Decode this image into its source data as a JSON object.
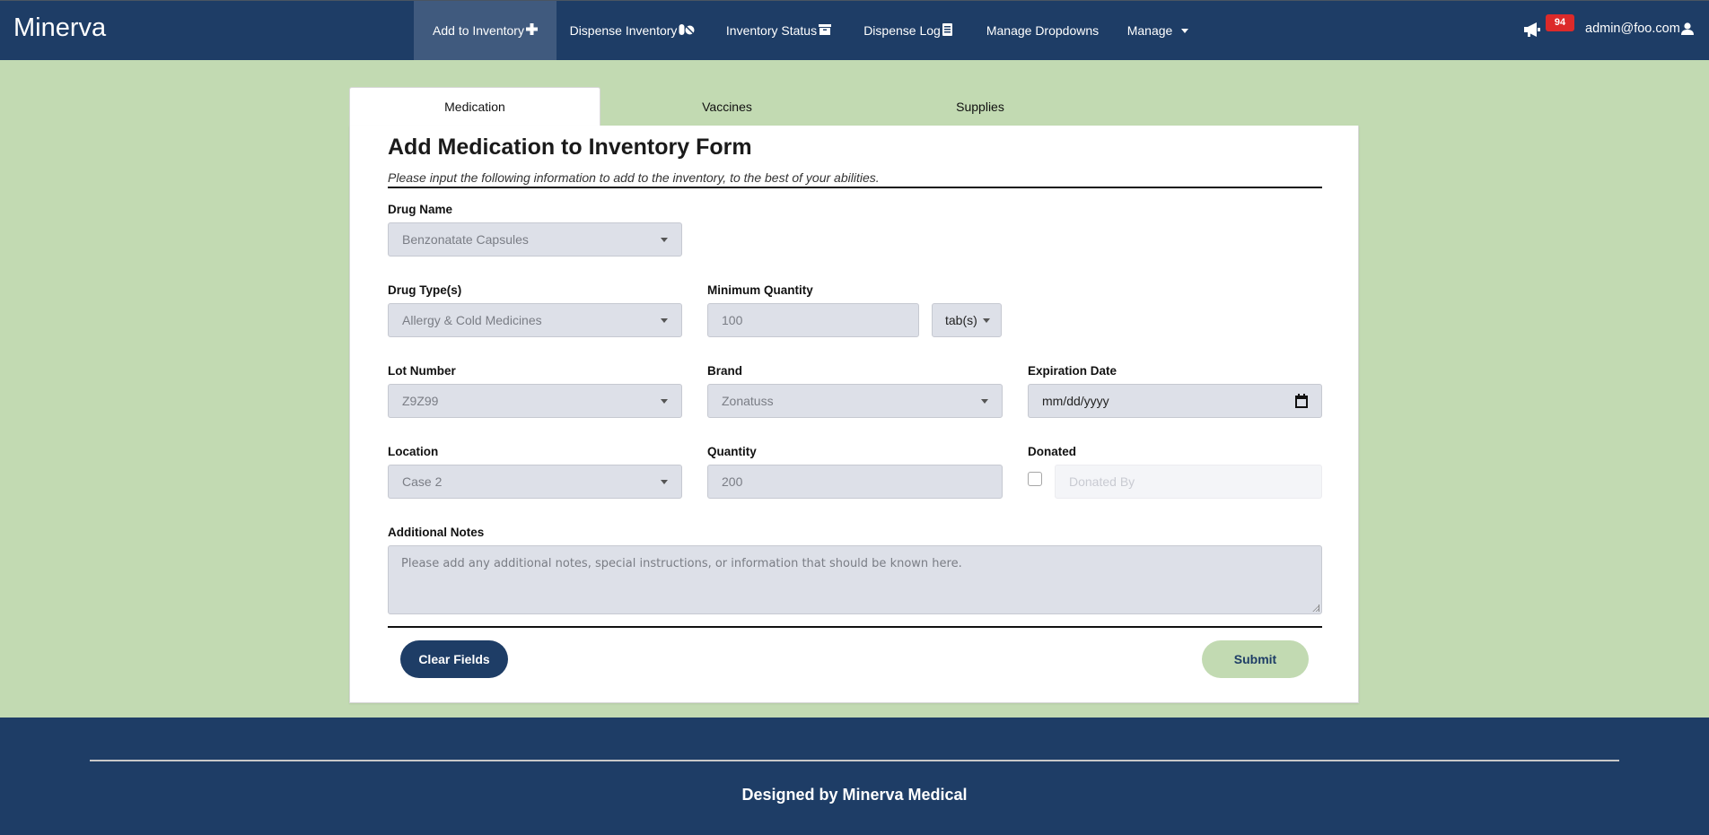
{
  "app": {
    "title": "Minerva"
  },
  "nav": {
    "items": [
      {
        "label": "Add to Inventory",
        "icon": "plus-icon",
        "active": true
      },
      {
        "label": "Dispense Inventory",
        "icon": "pills-icon",
        "active": false
      },
      {
        "label": "Inventory Status",
        "icon": "archive-icon",
        "active": false
      },
      {
        "label": "Dispense Log",
        "icon": "clipboard-icon",
        "active": false
      },
      {
        "label": "Manage Dropdowns",
        "icon": "",
        "active": false
      },
      {
        "label": "Manage",
        "icon": "caret-down-icon",
        "active": false
      }
    ],
    "notifications": {
      "icon": "megaphone-icon",
      "count": "94"
    },
    "user": {
      "email": "admin@foo.com",
      "icon": "user-icon"
    }
  },
  "tabs": [
    {
      "label": "Medication",
      "active": true
    },
    {
      "label": "Vaccines",
      "active": false
    },
    {
      "label": "Supplies",
      "active": false
    }
  ],
  "form": {
    "title": "Add Medication to Inventory Form",
    "subtitle": "Please input the following information to add to the inventory, to the best of your abilities.",
    "drug_name": {
      "label": "Drug Name",
      "value": "Benzonatate Capsules"
    },
    "drug_type": {
      "label": "Drug Type(s)",
      "value": "Allergy & Cold Medicines"
    },
    "min_quantity": {
      "label": "Minimum Quantity",
      "value": "100",
      "unit": "tab(s)"
    },
    "lot_number": {
      "label": "Lot Number",
      "value": "Z9Z99"
    },
    "brand": {
      "label": "Brand",
      "value": "Zonatuss"
    },
    "expiration": {
      "label": "Expiration Date",
      "placeholder": "mm/dd/yyyy"
    },
    "location": {
      "label": "Location",
      "value": "Case 2"
    },
    "quantity": {
      "label": "Quantity",
      "value": "200"
    },
    "donated": {
      "label": "Donated",
      "checked": false,
      "donated_by_placeholder": "Donated By"
    },
    "notes": {
      "label": "Additional Notes",
      "placeholder": "Please add any additional notes, special instructions, or information that should be known here."
    },
    "clear_label": "Clear Fields",
    "submit_label": "Submit"
  },
  "footer": {
    "text": "Designed by Minerva Medical"
  },
  "colors": {
    "primary": "#1e3d66",
    "accent": "#c2dab2",
    "badge": "#dc2a2a",
    "field_bg": "#dde0e8"
  }
}
